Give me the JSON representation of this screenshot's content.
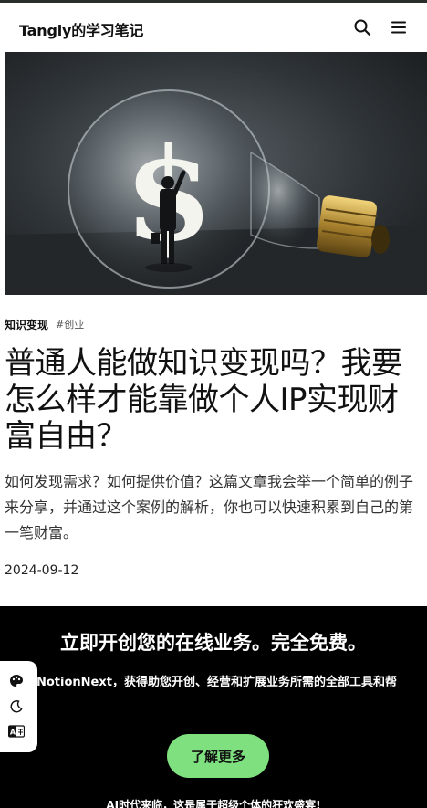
{
  "site": {
    "title": "Tangly的学习笔记"
  },
  "header": {
    "search_icon": "search-icon",
    "menu_icon": "hamburger-menu-icon"
  },
  "post": {
    "category": "知识变现",
    "tag": "#创业",
    "title": "普通人能做知识变现吗？我要怎么样才能靠做个人IP实现财富自由？",
    "summary": "如何发现需求？如何提供价值？这篇文章我会举一个简单的例子来分享，并通过这个案例的解析，你也可以快速积累到自己的第一笔财富。",
    "date": "2024-09-12"
  },
  "promo": {
    "title": "立即开创您的在线业务。完全免费。",
    "description": "NotionNext，获得助您开创、经营和扩展业务所需的全部工具和帮",
    "button_label": "了解更多",
    "footer": "AI时代来临，这是属于超级个体的狂欢盛宴!"
  },
  "float_tools": [
    {
      "icon": "palette-icon"
    },
    {
      "icon": "moon-icon"
    },
    {
      "icon": "translate-icon"
    }
  ],
  "colors": {
    "promo_bg": "#000000",
    "promo_button": "#7ee07f",
    "accent_text": "#111111"
  }
}
